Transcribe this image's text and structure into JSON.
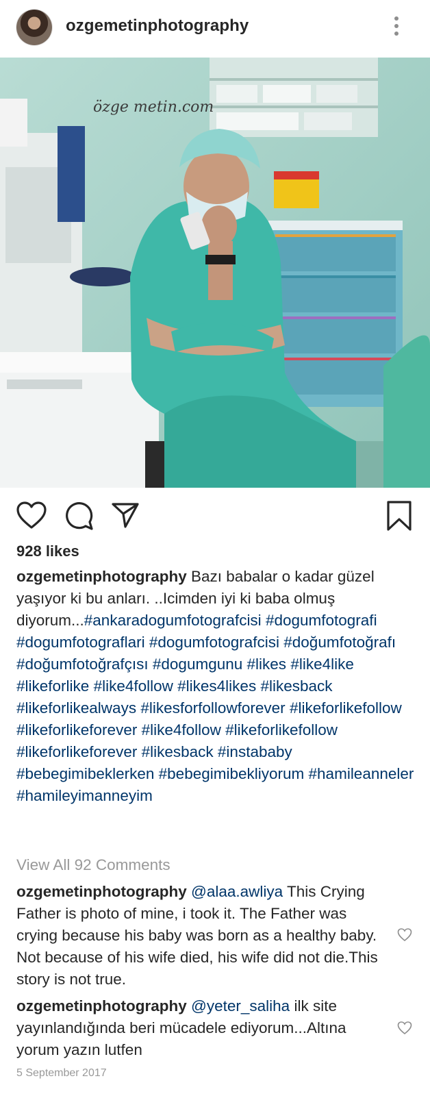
{
  "post": {
    "username": "ozgemetinphotography",
    "watermark": "özge metin.com",
    "likes": "928 likes",
    "caption_user": "ozgemetinphotography",
    "caption_text": "Bazı babalar o kadar güzel yaşıyor ki bu anları. ..Icimden iyi ki baba olmuş diyorum...",
    "hashtags": [
      "#ankaradogumfotografcisi",
      "#dogumfotografi",
      "#dogumfotograflari",
      "#dogumfotografcisi",
      "#doğumfotoğrafı",
      "#doğumfotoğrafçısı",
      "#dogumgunu",
      "#likes",
      "#like4like",
      "#likeforlike",
      "#like4follow",
      "#likes4likes",
      "#likesback",
      "#likeforlikealways",
      "#likesforfollowforever",
      "#likeforlikefollow",
      "#likeforlikeforever",
      "#like4follow",
      "#likeforlikefollow",
      "#likeforlikeforever",
      "#likesback",
      "#instababy",
      "#bebegimibeklerken",
      "#bebegimibekliyorum",
      "#hamileanneler",
      "#hamileyimanneyim"
    ],
    "view_all": "View All 92 Comments",
    "comments": [
      {
        "user": "ozgemetinphotography",
        "mention": "@alaa.awliya",
        "text": "This Crying Father is photo of mine, i took it. The Father was crying because his baby was born as a healthy baby. Not because of his wife died, his wife did not die.This story is not true."
      },
      {
        "user": "ozgemetinphotography",
        "mention": "@yeter_saliha",
        "text": "ilk site yayınlandığında beri mücadele ediyorum...Altına yorum yazın lutfen"
      }
    ],
    "date": "5 September 2017"
  },
  "icons": [
    "more-options-icon",
    "heart-icon",
    "comment-icon",
    "share-icon",
    "bookmark-icon",
    "comment-like-heart-icon"
  ],
  "colors": {
    "hashtag": "#003569",
    "muted": "#999999",
    "text": "#262626",
    "scrubs": "#3fb8a8"
  }
}
